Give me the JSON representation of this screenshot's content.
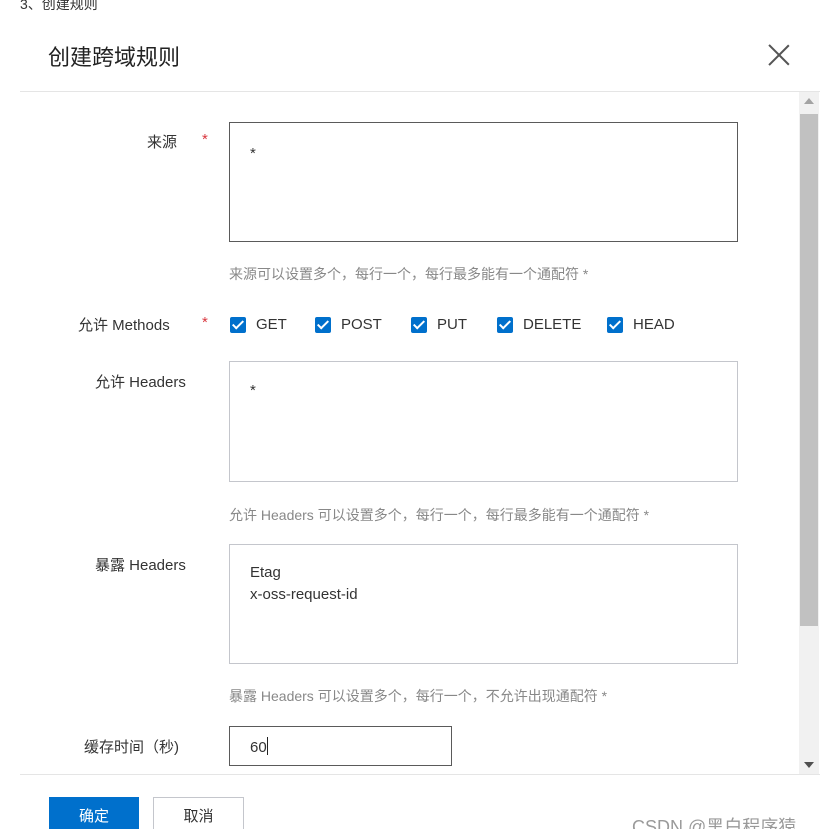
{
  "step_caption": "3、创建规则",
  "dialog": {
    "title": "创建跨域规则"
  },
  "form": {
    "origin": {
      "label": "来源",
      "required_mark": "*",
      "value": "*",
      "hint": "来源可以设置多个，每行一个，每行最多能有一个通配符 *"
    },
    "methods": {
      "label": "允许 Methods",
      "required_mark": "*",
      "options": [
        {
          "label": "GET",
          "checked": true
        },
        {
          "label": "POST",
          "checked": true
        },
        {
          "label": "PUT",
          "checked": true
        },
        {
          "label": "DELETE",
          "checked": true
        },
        {
          "label": "HEAD",
          "checked": true
        }
      ]
    },
    "allow_headers": {
      "label": "允许 Headers",
      "value": "*",
      "hint": "允许 Headers 可以设置多个，每行一个，每行最多能有一个通配符 *"
    },
    "expose_headers": {
      "label": "暴露 Headers",
      "value": "Etag\nx-oss-request-id",
      "hint": "暴露 Headers 可以设置多个，每行一个，不允许出现通配符 *"
    },
    "cache_time": {
      "label": "缓存时间（秒)",
      "value": "60"
    }
  },
  "footer": {
    "confirm_label": "确定",
    "cancel_label": "取消"
  },
  "watermark": "CSDN @黑白程序猿",
  "colors": {
    "primary": "#0070cc",
    "required": "#d9363e",
    "hint": "#888888"
  }
}
